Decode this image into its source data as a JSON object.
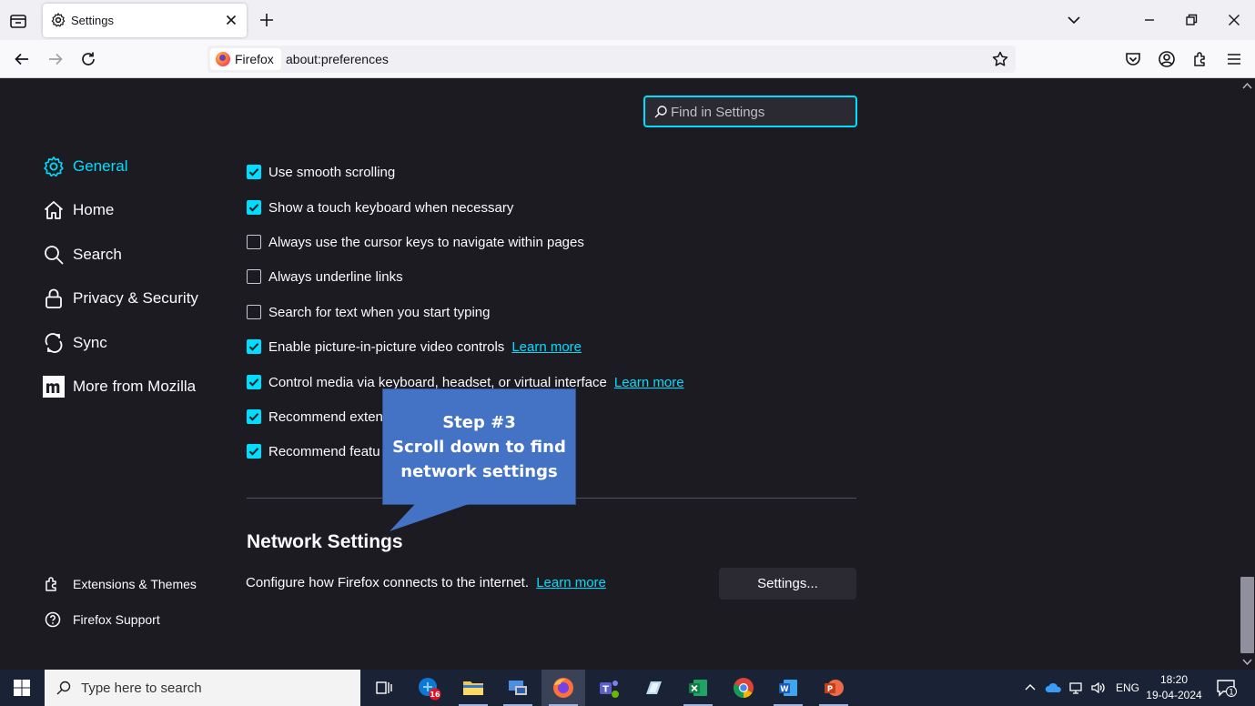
{
  "browser": {
    "tab_title": "Settings",
    "identity_label": "Firefox",
    "url": "about:preferences"
  },
  "search": {
    "placeholder": "Find in Settings"
  },
  "sidebar": {
    "categories": [
      {
        "label": "General",
        "icon": "gear-icon",
        "selected": true
      },
      {
        "label": "Home",
        "icon": "home-icon"
      },
      {
        "label": "Search",
        "icon": "search-icon"
      },
      {
        "label": "Privacy & Security",
        "icon": "lock-icon"
      },
      {
        "label": "Sync",
        "icon": "sync-icon"
      },
      {
        "label": "More from Mozilla",
        "icon": "mozilla-icon"
      }
    ],
    "footer": [
      {
        "label": "Extensions & Themes",
        "icon": "puzzle-icon"
      },
      {
        "label": "Firefox Support",
        "icon": "help-icon"
      }
    ]
  },
  "browsing": {
    "options": [
      {
        "label": "Use smooth scrolling",
        "checked": true
      },
      {
        "label": "Show a touch keyboard when necessary",
        "checked": true
      },
      {
        "label": "Always use the cursor keys to navigate within pages",
        "checked": false
      },
      {
        "label": "Always underline links",
        "checked": false
      },
      {
        "label": "Search for text when you start typing",
        "checked": false
      },
      {
        "label": "Enable picture-in-picture video controls",
        "checked": true,
        "link": "Learn more"
      },
      {
        "label": "Control media via keyboard, headset, or virtual interface",
        "checked": true,
        "link": "Learn more"
      },
      {
        "label": "Recommend exten",
        "checked": true
      },
      {
        "label": "Recommend featu",
        "checked": true
      }
    ]
  },
  "network": {
    "title": "Network Settings",
    "description": "Configure how Firefox connects to the internet.",
    "link": "Learn more",
    "button": "Settings..."
  },
  "callout": {
    "line1": "Step #3",
    "line2": "Scroll down to find",
    "line3": "network settings"
  },
  "taskbar": {
    "search_placeholder": "Type here to search",
    "mail_badge": "16",
    "language": "ENG",
    "time": "18:20",
    "date": "19-04-2024",
    "notification_count": "1"
  },
  "colors": {
    "accent": "#00ddff",
    "background": "#1c1b22",
    "callout": "#4472c4"
  }
}
